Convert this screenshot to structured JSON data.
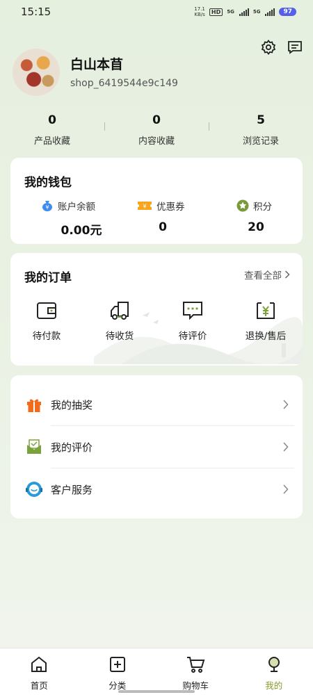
{
  "status_bar": {
    "time": "15:15",
    "net_speed_value": "17.1",
    "net_speed_unit": "KB/s",
    "hd_label": "HD",
    "sim1_label": "5G",
    "sim2_label": "5G",
    "battery": "97"
  },
  "profile": {
    "name": "白山本苜",
    "shop_id": "shop_6419544e9c149"
  },
  "stats": [
    {
      "value": "0",
      "label": "产品收藏"
    },
    {
      "value": "0",
      "label": "内容收藏"
    },
    {
      "value": "5",
      "label": "浏览记录"
    }
  ],
  "wallet": {
    "title": "我的钱包",
    "items": [
      {
        "label": "账户余额",
        "value": "0.00元",
        "icon": "money-bag-icon",
        "color": "#3d8df0"
      },
      {
        "label": "优惠券",
        "value": "0",
        "icon": "coupon-icon",
        "color": "#f5a623"
      },
      {
        "label": "积分",
        "value": "20",
        "icon": "star-badge-icon",
        "color": "#7a9a3a"
      }
    ]
  },
  "orders": {
    "title": "我的订单",
    "view_all": "查看全部",
    "items": [
      {
        "label": "待付款",
        "icon": "wallet-icon"
      },
      {
        "label": "待收货",
        "icon": "truck-icon"
      },
      {
        "label": "待评价",
        "icon": "comment-icon"
      },
      {
        "label": "退换/售后",
        "icon": "refund-icon"
      }
    ]
  },
  "menu": {
    "items": [
      {
        "label": "我的抽奖",
        "icon": "gift-icon",
        "color": "#f26b1d"
      },
      {
        "label": "我的评价",
        "icon": "review-icon",
        "color": "#7aa23a"
      },
      {
        "label": "客户服务",
        "icon": "customer-service-icon",
        "color": "#2a9bd8"
      }
    ]
  },
  "bottom_nav": {
    "items": [
      {
        "label": "首页",
        "icon": "home-icon"
      },
      {
        "label": "分类",
        "icon": "category-icon"
      },
      {
        "label": "购物车",
        "icon": "cart-icon"
      },
      {
        "label": "我的",
        "icon": "profile-icon"
      }
    ],
    "active_color": "#8a9a2a"
  }
}
